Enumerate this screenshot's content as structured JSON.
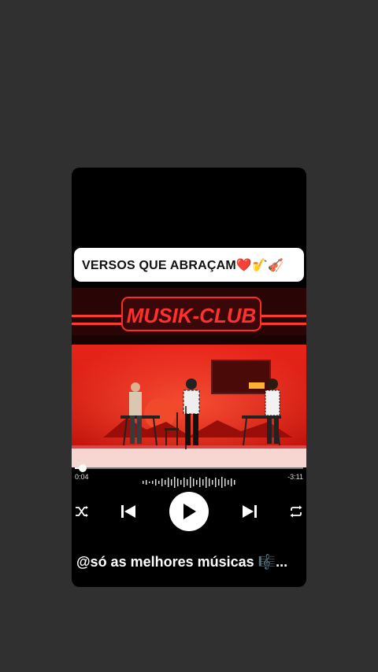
{
  "card": {
    "title": "VERSOS QUE ABRAÇAM❤️🎷🎻",
    "video": {
      "sign_text": "MUSIK-CLUB"
    },
    "player": {
      "elapsed": "0:04",
      "remaining": "-3:11",
      "progress_fraction": 0.035,
      "controls": {
        "shuffle": "shuffle-icon",
        "previous": "skip-previous-icon",
        "play": "play-icon",
        "next": "skip-next-icon",
        "repeat": "repeat-icon"
      }
    },
    "handle": "@só as melhores músicas 🎼..."
  },
  "colors": {
    "background": "#303030",
    "card": "#000000",
    "stage_red": "#e01a12",
    "neon": "#ff2a2a"
  }
}
